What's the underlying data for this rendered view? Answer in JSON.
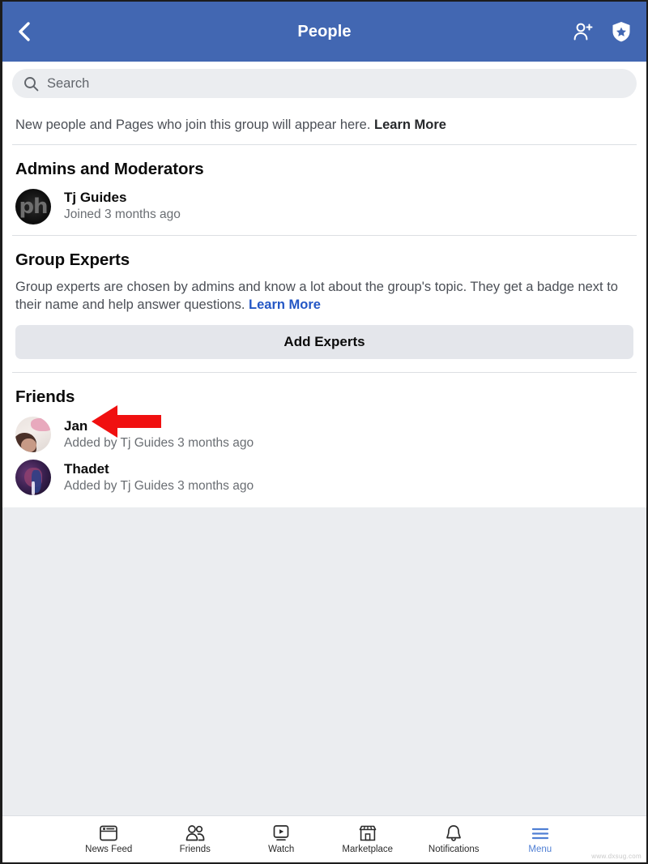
{
  "theme": {
    "header_blue": "#4267b2",
    "page_gray": "#ebedf0",
    "link_blue": "#2457c5",
    "accent_red": "#f01010",
    "active_nav_blue": "#4f7fd4"
  },
  "header": {
    "title": "People",
    "back_icon": "chevron-left-icon",
    "add_person_icon": "add-person-icon",
    "shield_star_icon": "shield-star-icon"
  },
  "search": {
    "icon": "search-icon",
    "placeholder": "Search",
    "value": ""
  },
  "notice": {
    "text": "New people and Pages who join this group will appear here. ",
    "link": "Learn More"
  },
  "sections": {
    "admins": {
      "title": "Admins and Moderators",
      "members": [
        {
          "name": "Tj Guides",
          "meta": "Joined 3 months ago",
          "avatar": "av-tj",
          "initials": "ph"
        }
      ]
    },
    "experts": {
      "title": "Group Experts",
      "blurb": "Group experts are chosen by admins and know a lot about the group's topic. They get a badge next to their name and help answer questions. ",
      "link": "Learn More",
      "button": "Add Experts"
    },
    "friends": {
      "title": "Friends",
      "members": [
        {
          "name": "Jan",
          "meta": "Added by Tj Guides 3 months ago",
          "avatar": "av-jan"
        },
        {
          "name": "Thadet",
          "meta": "Added by Tj Guides 3 months ago",
          "avatar": "av-thadet"
        }
      ]
    }
  },
  "annotation": {
    "shape": "left-arrow",
    "color": "#f01010",
    "points_at": "Jan"
  },
  "bottom_nav": {
    "items": [
      {
        "label": "News Feed",
        "icon": "news-feed-icon",
        "active": false
      },
      {
        "label": "Friends",
        "icon": "friends-icon",
        "active": false
      },
      {
        "label": "Watch",
        "icon": "watch-play-icon",
        "active": false
      },
      {
        "label": "Marketplace",
        "icon": "marketplace-store-icon",
        "active": false
      },
      {
        "label": "Notifications",
        "icon": "bell-icon",
        "active": false
      },
      {
        "label": "Menu",
        "icon": "hamburger-menu-icon",
        "active": true
      }
    ]
  },
  "watermark": "www.dxsug.com"
}
